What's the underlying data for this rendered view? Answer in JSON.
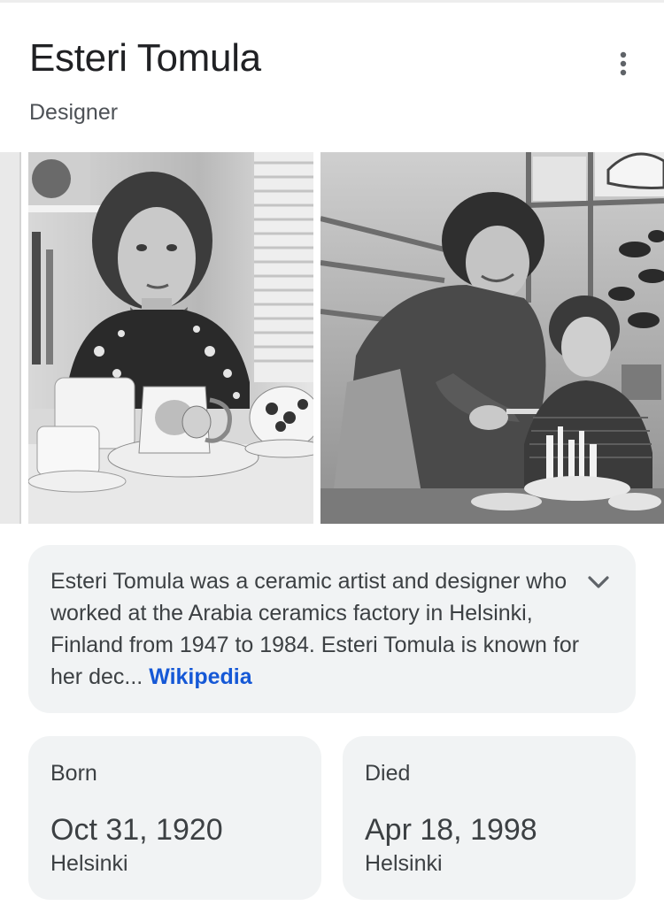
{
  "header": {
    "title": "Esteri Tomula",
    "subtitle": "Designer",
    "more_icon": "more-vert-icon"
  },
  "images": [
    {
      "name": "portrait-photo"
    },
    {
      "name": "workshop-photo"
    }
  ],
  "description": {
    "text": "Esteri Tomula was a ceramic artist and designer who worked at the Arabia ceramics factory in Helsinki, Finland from 1947 to 1984. Esteri Tomula is known for her dec",
    "ellipsis": "...",
    "source_link": "Wikipedia",
    "expand_icon": "chevron-down-icon"
  },
  "facts": {
    "born": {
      "label": "Born",
      "value": "Oct 31, 1920",
      "place": "Helsinki"
    },
    "died": {
      "label": "Died",
      "value": "Apr 18, 1998",
      "place": "Helsinki"
    }
  },
  "colors": {
    "link": "#1558d6",
    "card_bg": "#f1f3f4",
    "text": "#3c4043"
  }
}
